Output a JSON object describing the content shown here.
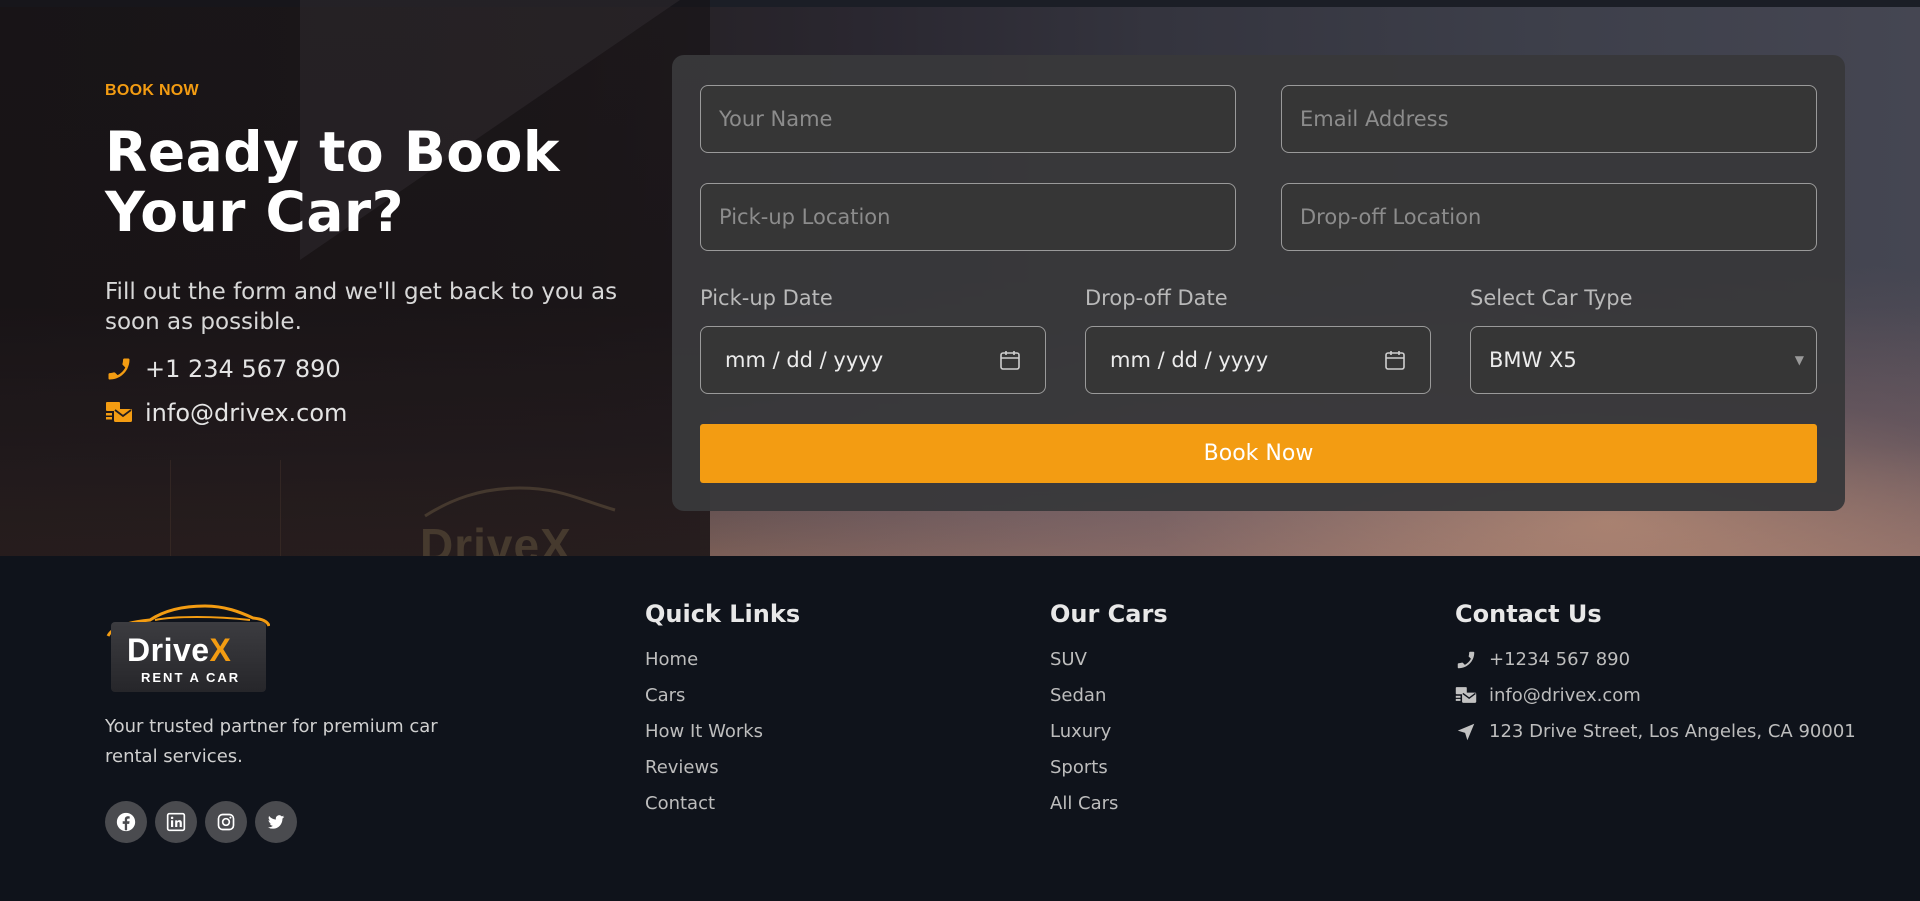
{
  "hero": {
    "eyebrow": "BOOK NOW",
    "title_line1": "Ready to Book",
    "title_line2": "Your Car?",
    "subtitle": "Fill out the form and we'll get back to you as soon as possible.",
    "phone": "+1 234 567 890",
    "email": "info@drivex.com",
    "watermark": "DriveX"
  },
  "form": {
    "name_placeholder": "Your Name",
    "email_placeholder": "Email Address",
    "pickup_location_placeholder": "Pick-up Location",
    "dropoff_location_placeholder": "Drop-off Location",
    "pickup_date_label": "Pick-up Date",
    "dropoff_date_label": "Drop-off Date",
    "car_type_label": "Select Car Type",
    "pickup_date_value": "mm / dd / yyyy",
    "dropoff_date_value": "mm / dd / yyyy",
    "car_type_value": "BMW X5",
    "submit_label": "Book Now"
  },
  "footer": {
    "brand": {
      "word_main": "Drive",
      "word_accent": "X",
      "tagline": "RENT A CAR"
    },
    "about": "Your trusted partner for premium car rental services.",
    "socials": [
      "facebook-icon",
      "linkedin-icon",
      "instagram-icon",
      "twitter-icon"
    ],
    "quick_links": {
      "heading": "Quick Links",
      "items": [
        "Home",
        "Cars",
        "How It Works",
        "Reviews",
        "Contact"
      ]
    },
    "our_cars": {
      "heading": "Our Cars",
      "items": [
        "SUV",
        "Sedan",
        "Luxury",
        "Sports",
        "All Cars"
      ]
    },
    "contact": {
      "heading": "Contact Us",
      "phone": "+1234 567 890",
      "email": "info@drivex.com",
      "address": "123 Drive Street, Los Angeles, CA 90001"
    }
  },
  "colors": {
    "accent": "#f39c12",
    "footer_bg": "#0f131b",
    "card_bg": "#383838"
  }
}
